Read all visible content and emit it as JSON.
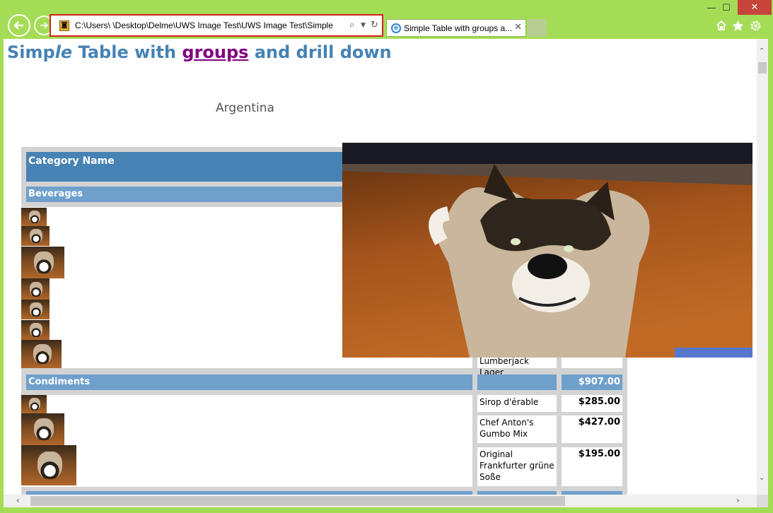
{
  "browser": {
    "address_text": "C:\\Users\\      \\Desktop\\Delme\\UWS Image Test\\UWS Image Test\\Simple",
    "tab_title": "Simple Table with groups a...",
    "tab_close": "✕",
    "window_buttons": {
      "minimize": "—",
      "maximize": "☐",
      "close": "✕"
    },
    "icons": [
      "back-arrow-icon",
      "forward-arrow-icon",
      "search-icon",
      "dropdown-icon",
      "refresh-icon",
      "home-icon",
      "favorites-star-icon",
      "settings-gear-icon"
    ]
  },
  "page": {
    "title_part1": "Simp",
    "title_part2": "le",
    "title_part3": " Table with ",
    "title_link": "groups",
    "title_part4": " and drill down",
    "country": "Argentina",
    "table": {
      "header": "Category Name",
      "groups": [
        {
          "name": "Beverages",
          "visible_items": [
            {
              "name": "Lumberjack Lager",
              "price": ""
            }
          ]
        },
        {
          "name": "Condiments",
          "total": "$907.00",
          "items": [
            {
              "name": "Sirop d'érable",
              "price": "$285.00"
            },
            {
              "name": "Chef Anton's Gumbo Mix",
              "price": "$427.00"
            },
            {
              "name": "Original Frankfurter grüne Soße",
              "price": "$195.00"
            }
          ]
        }
      ]
    }
  }
}
